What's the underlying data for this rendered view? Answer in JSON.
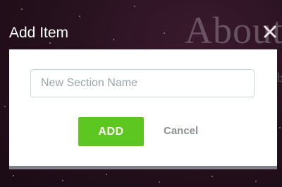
{
  "background": {
    "heading": "About",
    "edge_text": "b"
  },
  "dialog": {
    "title": "Add Item",
    "input_placeholder": "New Section Name",
    "input_value": "",
    "add_label": "ADD",
    "cancel_label": "Cancel",
    "close_icon": "close-icon"
  },
  "colors": {
    "add_button": "#5ec620",
    "cancel_text": "#8c9196",
    "backdrop": "#24101c"
  }
}
